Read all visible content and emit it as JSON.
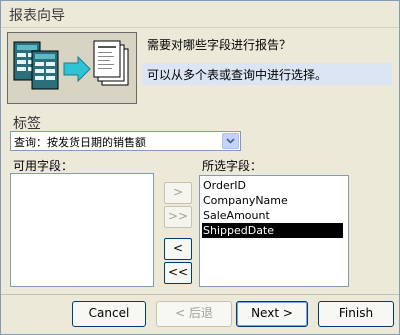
{
  "window": {
    "title": "报表向导"
  },
  "header": {
    "prompt": "需要对哪些字段进行报告？",
    "hint": "可以从多个表或查询中进行选择。"
  },
  "tables": {
    "label": "标签",
    "selected": "查询：按发货日期的销售额"
  },
  "available": {
    "label": "可用字段：",
    "items": []
  },
  "selected_fields": {
    "label": "所选字段：",
    "items": [
      "OrderID",
      "CompanyName",
      "SaleAmount",
      "ShippedDate"
    ],
    "selected_index": 3
  },
  "move_buttons": {
    "add_one": ">",
    "add_all": ">>",
    "remove_one": "<",
    "remove_all": "<<"
  },
  "footer": {
    "cancel": "Cancel",
    "back": "< 后退",
    "next": "Next >",
    "finish": "Finish"
  }
}
